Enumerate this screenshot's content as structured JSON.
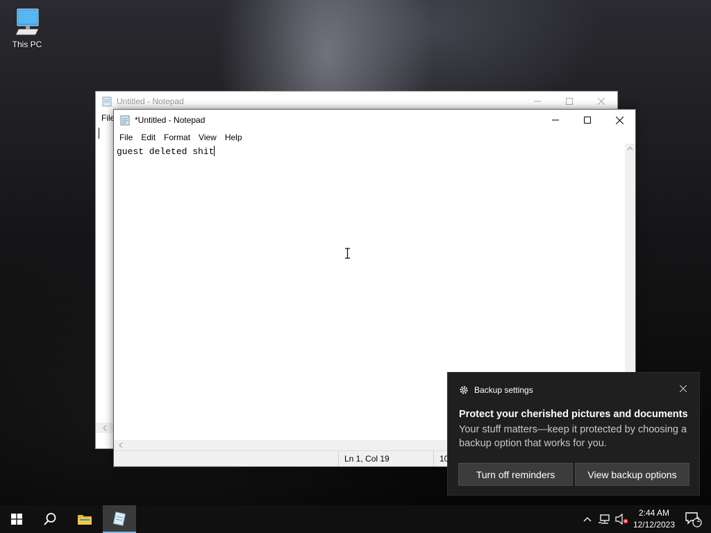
{
  "desktop": {
    "icons": [
      {
        "label": "This PC",
        "icon": "computer-icon"
      }
    ]
  },
  "back_window": {
    "title": "Untitled - Notepad",
    "menu_first": "File"
  },
  "front_window": {
    "title": "*Untitled - Notepad",
    "menu": [
      "File",
      "Edit",
      "Format",
      "View",
      "Help"
    ],
    "content": "guest deleted shit",
    "status": {
      "position": "Ln 1, Col 19",
      "zoom_partial": "10"
    }
  },
  "toast": {
    "app": "Backup settings",
    "heading": "Protect your cherished pictures and documents",
    "body": "Your stuff matters—keep it protected by choosing a backup option that works for you.",
    "buttons": [
      "Turn off reminders",
      "View backup options"
    ]
  },
  "taskbar": {
    "time": "2:44 AM",
    "date": "12/12/2023",
    "notification_count": "1"
  },
  "colors": {
    "taskbar": "#101010",
    "toast": "#1f1f1f",
    "active_indicator": "#7fb6e6"
  }
}
